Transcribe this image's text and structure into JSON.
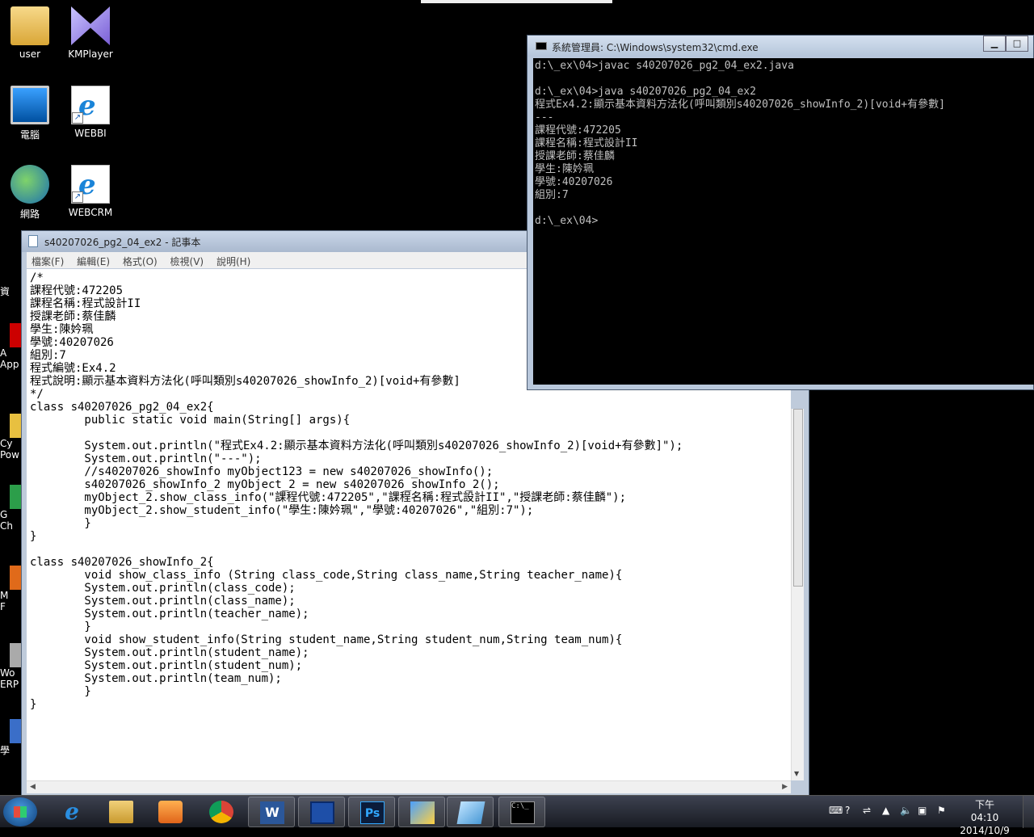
{
  "desktop": {
    "icons": [
      {
        "label": "user"
      },
      {
        "label": "KMPlayer"
      },
      {
        "label": "電腦"
      },
      {
        "label": "WEBBI"
      },
      {
        "label": "網路"
      },
      {
        "label": "WEBCRM"
      }
    ],
    "side_stubs": [
      "資",
      "A\nApp",
      "Cy\nPow",
      "G\nCh",
      "M\nF",
      "Wo\nERP",
      "學"
    ]
  },
  "notepad": {
    "title": "s40207026_pg2_04_ex2 - 記事本",
    "menu": [
      "檔案(F)",
      "編輯(E)",
      "格式(O)",
      "檢視(V)",
      "說明(H)"
    ],
    "content": "/*\n課程代號:472205\n課程名稱:程式設計II\n授課老師:蔡佳麟\n學生:陳妗珮\n學號:40207026\n組別:7\n程式編號:Ex4.2\n程式說明:顯示基本資料方法化(呼叫類別s40207026_showInfo_2)[void+有參數]\n*/\nclass s40207026_pg2_04_ex2{\n        public static void main(String[] args){\n\n        System.out.println(\"程式Ex4.2:顯示基本資料方法化(呼叫類別s40207026_showInfo_2)[void+有參數]\");\n        System.out.println(\"---\");\n        //s40207026_showInfo myObject123 = new s40207026_showInfo();\n        s40207026_showInfo_2 myObject_2 = new s40207026_showInfo_2();\n        myObject_2.show_class_info(\"課程代號:472205\",\"課程名稱:程式設計II\",\"授課老師:蔡佳麟\");\n        myObject_2.show_student_info(\"學生:陳妗珮\",\"學號:40207026\",\"組別:7\");\n        }\n}\n\nclass s40207026_showInfo_2{\n        void show_class_info (String class_code,String class_name,String teacher_name){\n        System.out.println(class_code);\n        System.out.println(class_name);\n        System.out.println(teacher_name);\n        }\n        void show_student_info(String student_name,String student_num,String team_num){\n        System.out.println(student_name);\n        System.out.println(student_num);\n        System.out.println(team_num);\n        }\n}"
  },
  "cmd": {
    "title": "系統管理員: C:\\Windows\\system32\\cmd.exe",
    "content": "d:\\_ex\\04>javac s40207026_pg2_04_ex2.java\n\nd:\\_ex\\04>java s40207026_pg2_04_ex2\n程式Ex4.2:顯示基本資料方法化(呼叫類別s40207026_showInfo_2)[void+有參數]\n---\n課程代號:472205\n課程名稱:程式設計II\n授課老師:蔡佳麟\n學生:陳妗珮\n學號:40207026\n組別:7\n\nd:\\_ex\\04>"
  },
  "taskbar": {
    "cmd_label": "C:\\_",
    "ps_label": "Ps",
    "word_label": "W",
    "clock_time": "下午 04:10",
    "clock_date": "2014/10/9"
  }
}
